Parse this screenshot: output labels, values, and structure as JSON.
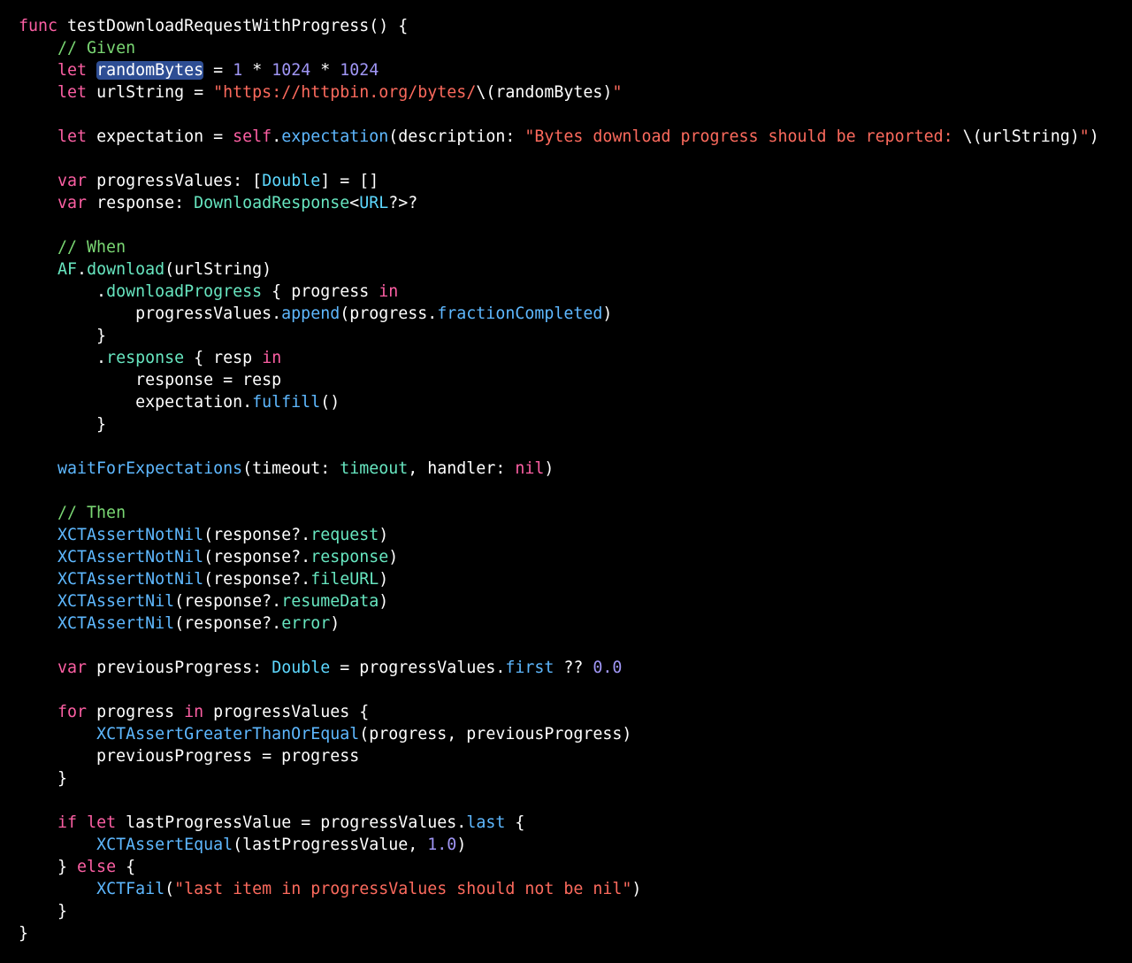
{
  "editor": {
    "language": "swift",
    "theme": {
      "background": "#000000",
      "plain": "#ffffff",
      "keyword": "#fc5fa3",
      "comment": "#7ad773",
      "string": "#fc6a5d",
      "number": "#a096f5",
      "type": "#5dd8ff",
      "property": "#67e6c0",
      "method": "#5eb8ff",
      "selection": "#2e4e94"
    },
    "selected_token": "randomBytes",
    "lines": [
      [
        [
          "kw",
          "func"
        ],
        [
          "plain",
          " testDownloadRequestWithProgress() {"
        ]
      ],
      [
        [
          "plain",
          "    "
        ],
        [
          "comment",
          "// Given"
        ]
      ],
      [
        [
          "plain",
          "    "
        ],
        [
          "kw",
          "let"
        ],
        [
          "plain",
          " "
        ],
        [
          "sel",
          "randomBytes"
        ],
        [
          "plain",
          " = "
        ],
        [
          "number",
          "1"
        ],
        [
          "plain",
          " * "
        ],
        [
          "number",
          "1024"
        ],
        [
          "plain",
          " * "
        ],
        [
          "number",
          "1024"
        ]
      ],
      [
        [
          "plain",
          "    "
        ],
        [
          "kw",
          "let"
        ],
        [
          "plain",
          " urlString = "
        ],
        [
          "string",
          "\"https://httpbin.org/bytes/"
        ],
        [
          "plain",
          "\\("
        ],
        [
          "plain",
          "randomBytes"
        ],
        [
          "plain",
          ")"
        ],
        [
          "string",
          "\""
        ]
      ],
      [],
      [
        [
          "plain",
          "    "
        ],
        [
          "kw",
          "let"
        ],
        [
          "plain",
          " expectation = "
        ],
        [
          "kw",
          "self"
        ],
        [
          "plain",
          "."
        ],
        [
          "method",
          "expectation"
        ],
        [
          "plain",
          "(description: "
        ],
        [
          "string",
          "\"Bytes download progress should be reported: "
        ],
        [
          "plain",
          "\\("
        ],
        [
          "plain",
          "urlString"
        ],
        [
          "plain",
          ")"
        ],
        [
          "string",
          "\""
        ],
        [
          "plain",
          ")"
        ]
      ],
      [],
      [
        [
          "plain",
          "    "
        ],
        [
          "kw",
          "var"
        ],
        [
          "plain",
          " progressValues: ["
        ],
        [
          "type",
          "Double"
        ],
        [
          "plain",
          "] = []"
        ]
      ],
      [
        [
          "plain",
          "    "
        ],
        [
          "kw",
          "var"
        ],
        [
          "plain",
          " response: "
        ],
        [
          "prop",
          "DownloadResponse"
        ],
        [
          "plain",
          "<"
        ],
        [
          "type",
          "URL"
        ],
        [
          "plain",
          "?>?"
        ]
      ],
      [],
      [
        [
          "plain",
          "    "
        ],
        [
          "comment",
          "// When"
        ]
      ],
      [
        [
          "plain",
          "    "
        ],
        [
          "prop",
          "AF"
        ],
        [
          "plain",
          "."
        ],
        [
          "prop",
          "download"
        ],
        [
          "plain",
          "(urlString)"
        ]
      ],
      [
        [
          "plain",
          "        ."
        ],
        [
          "prop",
          "downloadProgress"
        ],
        [
          "plain",
          " { progress "
        ],
        [
          "kw",
          "in"
        ]
      ],
      [
        [
          "plain",
          "            progressValues."
        ],
        [
          "method",
          "append"
        ],
        [
          "plain",
          "(progress."
        ],
        [
          "method",
          "fractionCompleted"
        ],
        [
          "plain",
          ")"
        ]
      ],
      [
        [
          "plain",
          "        }"
        ]
      ],
      [
        [
          "plain",
          "        ."
        ],
        [
          "prop",
          "response"
        ],
        [
          "plain",
          " { resp "
        ],
        [
          "kw",
          "in"
        ]
      ],
      [
        [
          "plain",
          "            response = resp"
        ]
      ],
      [
        [
          "plain",
          "            expectation."
        ],
        [
          "method",
          "fulfill"
        ],
        [
          "plain",
          "()"
        ]
      ],
      [
        [
          "plain",
          "        }"
        ]
      ],
      [],
      [
        [
          "plain",
          "    "
        ],
        [
          "method",
          "waitForExpectations"
        ],
        [
          "plain",
          "(timeout: "
        ],
        [
          "prop",
          "timeout"
        ],
        [
          "plain",
          ", handler: "
        ],
        [
          "kw",
          "nil"
        ],
        [
          "plain",
          ")"
        ]
      ],
      [],
      [
        [
          "plain",
          "    "
        ],
        [
          "comment",
          "// Then"
        ]
      ],
      [
        [
          "plain",
          "    "
        ],
        [
          "method",
          "XCTAssertNotNil"
        ],
        [
          "plain",
          "(response?."
        ],
        [
          "prop",
          "request"
        ],
        [
          "plain",
          ")"
        ]
      ],
      [
        [
          "plain",
          "    "
        ],
        [
          "method",
          "XCTAssertNotNil"
        ],
        [
          "plain",
          "(response?."
        ],
        [
          "prop",
          "response"
        ],
        [
          "plain",
          ")"
        ]
      ],
      [
        [
          "plain",
          "    "
        ],
        [
          "method",
          "XCTAssertNotNil"
        ],
        [
          "plain",
          "(response?."
        ],
        [
          "prop",
          "fileURL"
        ],
        [
          "plain",
          ")"
        ]
      ],
      [
        [
          "plain",
          "    "
        ],
        [
          "method",
          "XCTAssertNil"
        ],
        [
          "plain",
          "(response?."
        ],
        [
          "prop",
          "resumeData"
        ],
        [
          "plain",
          ")"
        ]
      ],
      [
        [
          "plain",
          "    "
        ],
        [
          "method",
          "XCTAssertNil"
        ],
        [
          "plain",
          "(response?."
        ],
        [
          "prop",
          "error"
        ],
        [
          "plain",
          ")"
        ]
      ],
      [],
      [
        [
          "plain",
          "    "
        ],
        [
          "kw",
          "var"
        ],
        [
          "plain",
          " previousProgress: "
        ],
        [
          "type",
          "Double"
        ],
        [
          "plain",
          " = progressValues."
        ],
        [
          "method",
          "first"
        ],
        [
          "plain",
          " ?? "
        ],
        [
          "number",
          "0.0"
        ]
      ],
      [],
      [
        [
          "plain",
          "    "
        ],
        [
          "kw",
          "for"
        ],
        [
          "plain",
          " progress "
        ],
        [
          "kw",
          "in"
        ],
        [
          "plain",
          " progressValues {"
        ]
      ],
      [
        [
          "plain",
          "        "
        ],
        [
          "method",
          "XCTAssertGreaterThanOrEqual"
        ],
        [
          "plain",
          "(progress, previousProgress)"
        ]
      ],
      [
        [
          "plain",
          "        previousProgress = progress"
        ]
      ],
      [
        [
          "plain",
          "    }"
        ]
      ],
      [],
      [
        [
          "plain",
          "    "
        ],
        [
          "kw",
          "if"
        ],
        [
          "plain",
          " "
        ],
        [
          "kw",
          "let"
        ],
        [
          "plain",
          " lastProgressValue = progressValues."
        ],
        [
          "method",
          "last"
        ],
        [
          "plain",
          " {"
        ]
      ],
      [
        [
          "plain",
          "        "
        ],
        [
          "method",
          "XCTAssertEqual"
        ],
        [
          "plain",
          "(lastProgressValue, "
        ],
        [
          "number",
          "1.0"
        ],
        [
          "plain",
          ")"
        ]
      ],
      [
        [
          "plain",
          "    } "
        ],
        [
          "kw",
          "else"
        ],
        [
          "plain",
          " {"
        ]
      ],
      [
        [
          "plain",
          "        "
        ],
        [
          "method",
          "XCTFail"
        ],
        [
          "plain",
          "("
        ],
        [
          "string",
          "\"last item in progressValues should not be nil\""
        ],
        [
          "plain",
          ")"
        ]
      ],
      [
        [
          "plain",
          "    }"
        ]
      ],
      [
        [
          "plain",
          "}"
        ]
      ]
    ]
  }
}
